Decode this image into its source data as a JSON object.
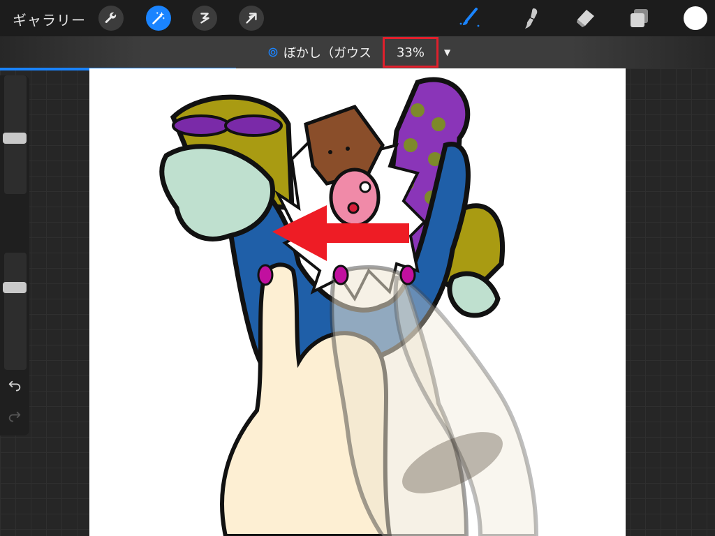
{
  "toolbar": {
    "gallery_label": "ギャラリー",
    "left_tools": [
      "wrench-icon",
      "magic-wand-icon",
      "selection-icon",
      "transform-arrow-icon"
    ],
    "right_tools": [
      "brush-icon",
      "smudge-icon",
      "eraser-icon",
      "layers-icon",
      "color-swatch"
    ],
    "active_tool_color": "#1a84ff",
    "current_color": "#ffffff"
  },
  "adjustment": {
    "icon": "gaussian-blur-icon",
    "name": "ぼかし（ガウス",
    "percentage": "33%",
    "highlight_color": "#e0202c",
    "progress_fraction": 0.33
  },
  "sidebar": {
    "brush_size_level": 0.45,
    "opacity_level": 0.3,
    "modify_button": "square-icon",
    "undo": "undo-icon",
    "redo": "redo-icon"
  },
  "canvas": {
    "background": "#ffffff",
    "arrow_color": "#ee1c25",
    "content": "illustration"
  }
}
